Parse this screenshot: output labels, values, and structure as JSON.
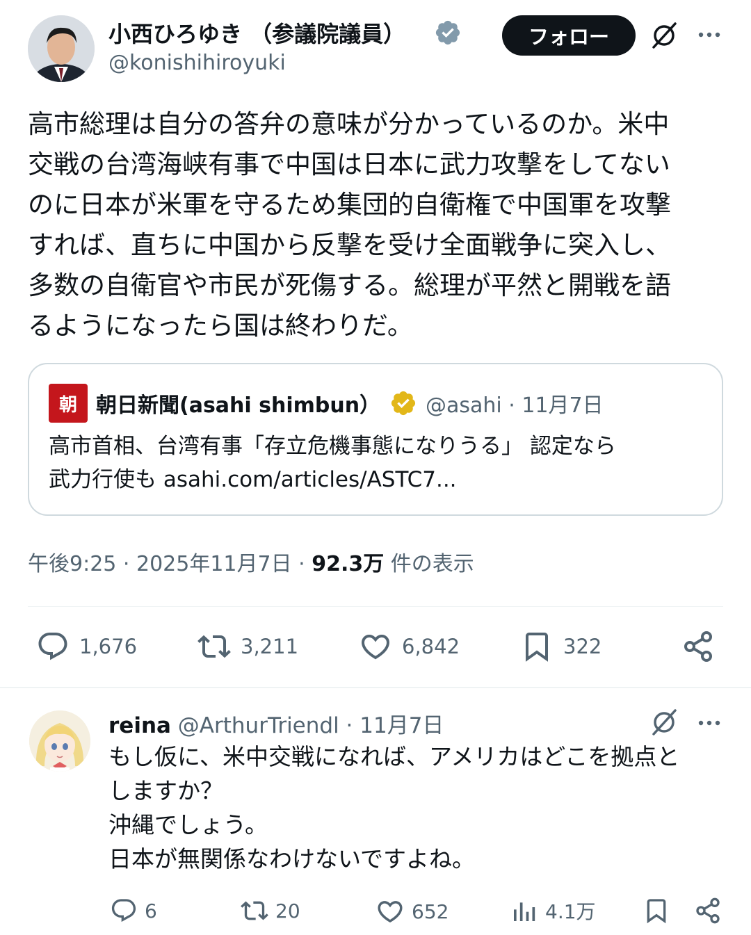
{
  "post": {
    "author_name": "小西ひろゆき （参議院議員）",
    "author_handle": "@konishihiroyuki",
    "follow_label": "フォロー",
    "text_lines": [
      "高市総理は自分の答弁の意味が分かっているのか。米中",
      "交戦の台湾海峡有事で中国は日本に武力攻撃をしてない",
      "のに日本が米軍を守るため集団的自衛権で中国軍を攻撃",
      "すれば、直ちに中国から反撃を受け全面戦争に突入し、",
      "多数の自衛官や市民が死傷する。総理が平然と開戦を語",
      "るようになったら国は終わりだ。"
    ],
    "quote": {
      "logo_text": "朝",
      "name": "朝日新聞(asahi shimbun）",
      "meta": "@asahi · 11月7日",
      "text_lines": [
        "高市首相、台湾有事「存立危機事態になりうる」 認定なら",
        "武力行使も asahi.com/articles/ASTC7..."
      ]
    },
    "timestamp": "午後9:25 · 2025年11月7日 · ",
    "views_count": "92.3万",
    "views_label": " 件の表示",
    "stats": {
      "replies": "1,676",
      "reposts": "3,211",
      "likes": "6,842",
      "bookmarks": "322"
    }
  },
  "reply": {
    "name": "reina",
    "meta": " @ArthurTriendl · 11月7日",
    "text_lines": [
      "もし仮に、米中交戦になれば、アメリカはどこを拠点と",
      "しますか？",
      "沖縄でしょう。",
      "日本が無関係なわけないですよね。"
    ],
    "stats": {
      "replies": "6",
      "reposts": "20",
      "likes": "652",
      "views": "4.1万"
    }
  },
  "icons": {
    "verified_main": "verified-badge-icon",
    "verified_quote": "verified-gold-badge-icon",
    "grok": "grok-icon",
    "more": "more-dots-icon",
    "reply": "reply-bubble-icon",
    "repost": "repost-icon",
    "like": "heart-icon",
    "bookmark": "bookmark-icon",
    "share": "share-icon",
    "views": "views-chart-icon"
  },
  "colors": {
    "text": "#0f1419",
    "secondary": "#536471",
    "verified_blue_grey": "#829aab",
    "verified_gold": "#e2b719",
    "asahi_red": "#c4161c",
    "follow_bg": "#0f1419"
  }
}
